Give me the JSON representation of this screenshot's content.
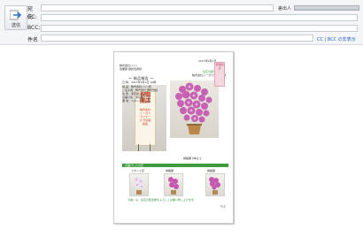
{
  "toolbar": {
    "send_label": "送信"
  },
  "fields": {
    "to_label": "宛先:",
    "cc_label": "CC:",
    "bcc_label": "BCC:",
    "subject_label": "件名",
    "from_label": "差出人",
    "ccbcc_link": "CC | BCC の非表示"
  },
  "document": {
    "date": "2017年9月1日",
    "recipient_1": "株式会社○○○",
    "recipient_2": "営業部 御担当者様",
    "sender_1": "生花の配達屋",
    "sender_2": "株式会社シーガスワイヤーズ",
    "heading": "〜 納品報告 〜",
    "detail_lines": [
      "日  時：2017年9月1日 10時",
      "納  品：株式会社○○○様",
      "ご注文者：株式会社 御担当様",
      "住  所：東京都○○区",
      "お届け先：東京都○○区",
      "備  考：スタンド花 二段"
    ],
    "card_title": "祝御開店",
    "card_sub": "株式会社シーガスワイヤーズ 代表取締役",
    "pink_card": "祝御開店",
    "caption_right": "胡蝶蘭 5本立て",
    "band_text": "お届けしたお花",
    "thumb_captions": [
      "スタンド花",
      "胡蝶蘭",
      "胡蝶蘭"
    ],
    "footer_note": "今後とも、生花の配達屋をよろしくお願い申し上げます。",
    "footer_right": "以上",
    "colors": {
      "green": "#3e9b3e",
      "orchid": "#c557b0",
      "card_red": "#c23a1a"
    }
  }
}
